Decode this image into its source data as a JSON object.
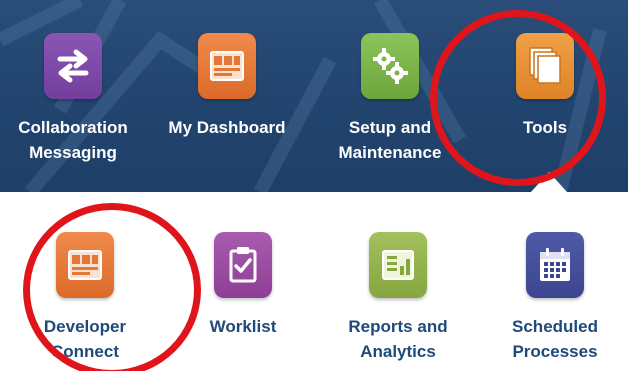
{
  "top_row": [
    {
      "label_line1": "Collaboration",
      "label_line2": "Messaging",
      "icon": "exchange-arrows-icon",
      "color": "#7d4aab"
    },
    {
      "label_line1": "My Dashboard",
      "label_line2": "",
      "icon": "dashboard-panel-icon",
      "color": "#e47736"
    },
    {
      "label_line1": "Setup and",
      "label_line2": "Maintenance",
      "icon": "gears-icon",
      "color": "#7db24d"
    },
    {
      "label_line1": "Tools",
      "label_line2": "",
      "icon": "stacked-pages-icon",
      "color": "#e8912f"
    }
  ],
  "bottom_row": [
    {
      "label_line1": "Developer",
      "label_line2": "Connect",
      "icon": "developer-panel-icon",
      "color": "#e47736"
    },
    {
      "label_line1": "Worklist",
      "label_line2": "",
      "icon": "clipboard-check-icon",
      "color": "#9b4ba3"
    },
    {
      "label_line1": "Reports and",
      "label_line2": "Analytics",
      "icon": "report-chart-icon",
      "color": "#94b34d"
    },
    {
      "label_line1": "Scheduled",
      "label_line2": "Processes",
      "icon": "calendar-icon",
      "color": "#444f9b"
    }
  ],
  "colors": {
    "header_band": "#21446e",
    "highlight_circle": "#e0151c",
    "bottom_label": "#1f4a7a"
  }
}
